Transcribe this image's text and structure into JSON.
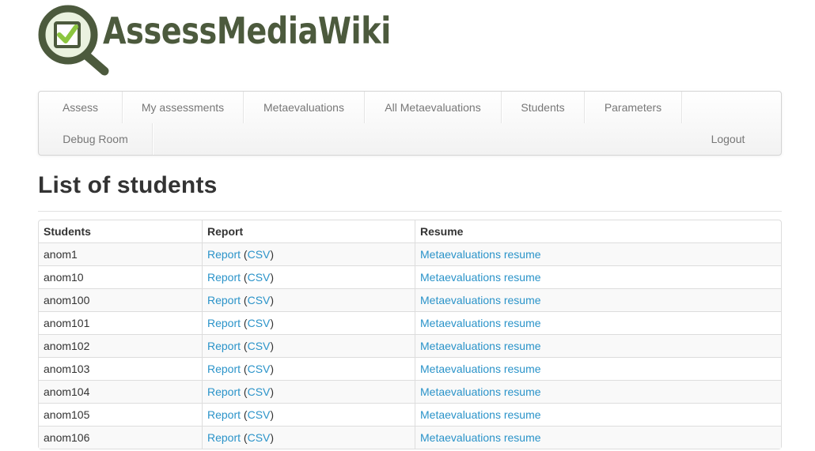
{
  "header": {
    "logo_text": "AssessMediaWiki",
    "logo_icon": "magnifier-checkbox-icon"
  },
  "nav": {
    "items": [
      {
        "label": "Assess"
      },
      {
        "label": "My assessments"
      },
      {
        "label": "Metaevaluations"
      },
      {
        "label": "All Metaevaluations"
      },
      {
        "label": "Students"
      },
      {
        "label": "Parameters"
      },
      {
        "label": "Debug Room"
      }
    ],
    "logout_label": "Logout"
  },
  "main": {
    "title": "List of students",
    "table": {
      "headers": [
        "Students",
        "Report",
        "Resume"
      ],
      "rows": [
        {
          "student": "anom1",
          "report": "Report",
          "open_paren": "(",
          "csv": "CSV",
          "close_paren": ")",
          "resume": "Metaevaluations resume"
        },
        {
          "student": "anom10",
          "report": "Report",
          "open_paren": "(",
          "csv": "CSV",
          "close_paren": ")",
          "resume": "Metaevaluations resume"
        },
        {
          "student": "anom100",
          "report": "Report",
          "open_paren": "(",
          "csv": "CSV",
          "close_paren": ")",
          "resume": "Metaevaluations resume"
        },
        {
          "student": "anom101",
          "report": "Report",
          "open_paren": "(",
          "csv": "CSV",
          "close_paren": ")",
          "resume": "Metaevaluations resume"
        },
        {
          "student": "anom102",
          "report": "Report",
          "open_paren": "(",
          "csv": "CSV",
          "close_paren": ")",
          "resume": "Metaevaluations resume"
        },
        {
          "student": "anom103",
          "report": "Report",
          "open_paren": "(",
          "csv": "CSV",
          "close_paren": ")",
          "resume": "Metaevaluations resume"
        },
        {
          "student": "anom104",
          "report": "Report",
          "open_paren": "(",
          "csv": "CSV",
          "close_paren": ")",
          "resume": "Metaevaluations resume"
        },
        {
          "student": "anom105",
          "report": "Report",
          "open_paren": "(",
          "csv": "CSV",
          "close_paren": ")",
          "resume": "Metaevaluations resume"
        },
        {
          "student": "anom106",
          "report": "Report",
          "open_paren": "(",
          "csv": "CSV",
          "close_paren": ")",
          "resume": "Metaevaluations resume"
        }
      ]
    }
  },
  "colors": {
    "logo_green": "#4c5a3d",
    "logo_light_green": "#8cc63f",
    "link": "#2a93c9",
    "nav_text": "#777777",
    "heading": "#333333"
  }
}
